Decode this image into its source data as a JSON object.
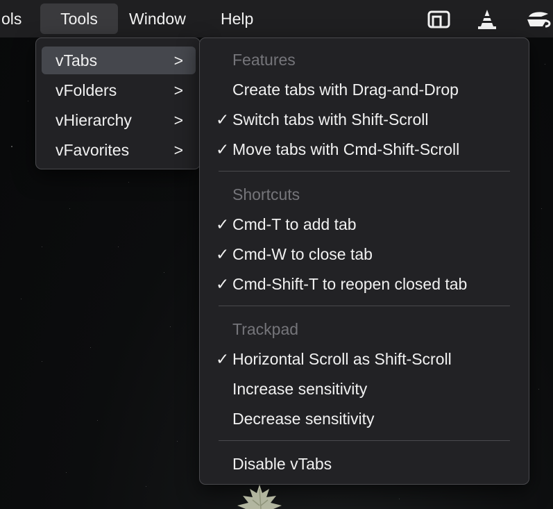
{
  "menubar": {
    "items": [
      "ols",
      "Tools",
      "Window",
      "Help"
    ],
    "active": "Tools",
    "status_icons": [
      "cast-icon",
      "vlc-cone-icon",
      "app-logo-icon"
    ]
  },
  "tools_menu": {
    "items": [
      {
        "label": "vTabs",
        "arrow": ">"
      },
      {
        "label": "vFolders",
        "arrow": ">"
      },
      {
        "label": "vHierarchy",
        "arrow": ">"
      },
      {
        "label": "vFavorites",
        "arrow": ">"
      }
    ],
    "selected": "vTabs"
  },
  "vtabs_menu": {
    "sections": [
      {
        "header": "Features",
        "items": [
          {
            "check": "",
            "label": "Create tabs with Drag-and-Drop"
          },
          {
            "check": "✓",
            "label": "Switch tabs with Shift-Scroll"
          },
          {
            "check": "✓",
            "label": "Move tabs with Cmd-Shift-Scroll"
          }
        ]
      },
      {
        "header": "Shortcuts",
        "items": [
          {
            "check": "✓",
            "label": "Cmd-T to add tab"
          },
          {
            "check": "✓",
            "label": "Cmd-W to close tab"
          },
          {
            "check": "✓",
            "label": "Cmd-Shift-T to reopen closed tab"
          }
        ]
      },
      {
        "header": "Trackpad",
        "items": [
          {
            "check": "✓",
            "label": "Horizontal Scroll as Shift-Scroll"
          },
          {
            "check": "",
            "label": "Increase sensitivity"
          },
          {
            "check": "",
            "label": "Decrease sensitivity"
          }
        ]
      }
    ],
    "footer": {
      "label": "Disable vTabs"
    }
  },
  "colors": {
    "menu_bg": "#222225",
    "menubar_bg": "#1f1f21",
    "selected_bg": "#45474d",
    "header_text": "#75757a",
    "text": "#f1f1f1"
  }
}
